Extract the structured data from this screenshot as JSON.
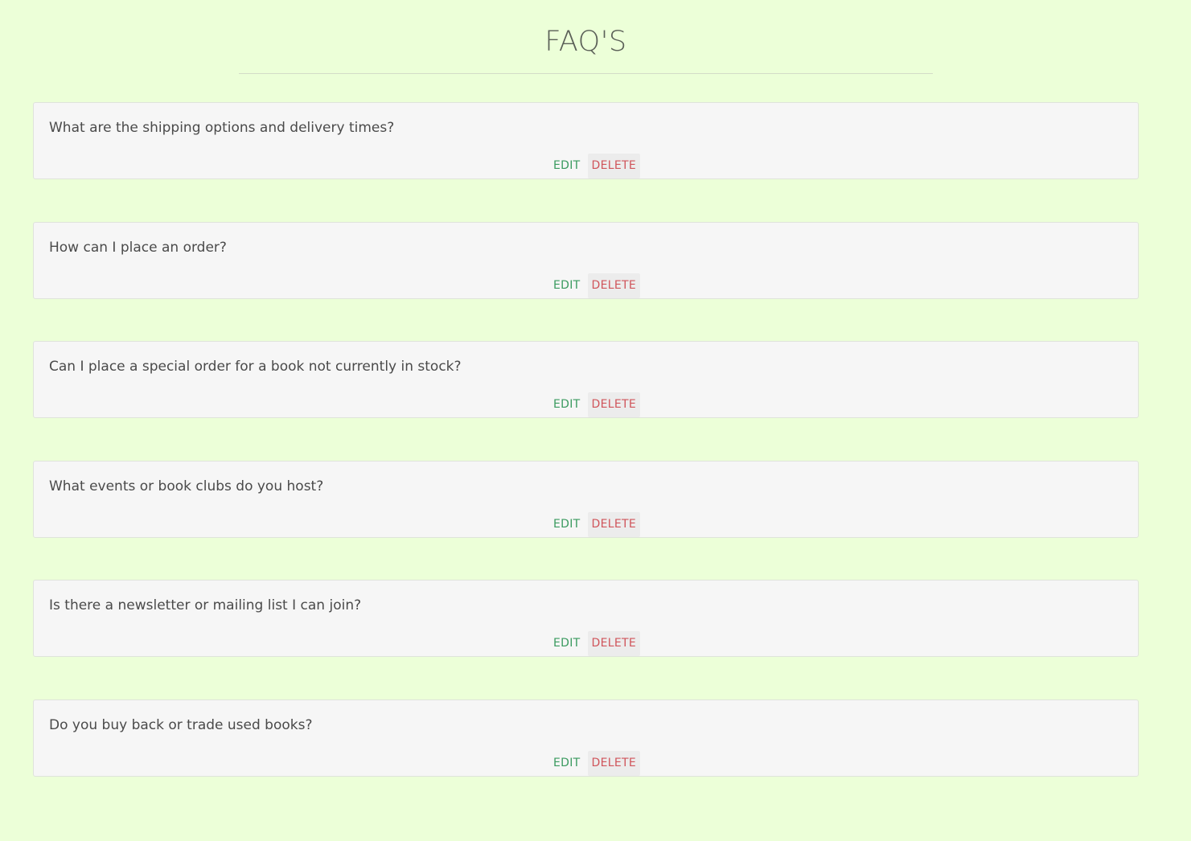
{
  "page": {
    "title": "FAQ'S"
  },
  "faqs": [
    {
      "question": "What are the shipping options and delivery times?",
      "edit_label": "EDIT",
      "delete_label": "DELETE"
    },
    {
      "question": "How can I place an order?",
      "edit_label": "EDIT",
      "delete_label": "DELETE"
    },
    {
      "question": "Can I place a special order for a book not currently in stock?",
      "edit_label": "EDIT",
      "delete_label": "DELETE"
    },
    {
      "question": "What events or book clubs do you host?",
      "edit_label": "EDIT",
      "delete_label": "DELETE"
    },
    {
      "question": "Is there a newsletter or mailing list I can join?",
      "edit_label": "EDIT",
      "delete_label": "DELETE"
    },
    {
      "question": "Do you buy back or trade used books?",
      "edit_label": "EDIT",
      "delete_label": "DELETE"
    }
  ],
  "colors": {
    "background": "#ecffd8",
    "card": "#f6f6f6",
    "edit": "#3a9a5f",
    "delete": "#d0555b"
  }
}
